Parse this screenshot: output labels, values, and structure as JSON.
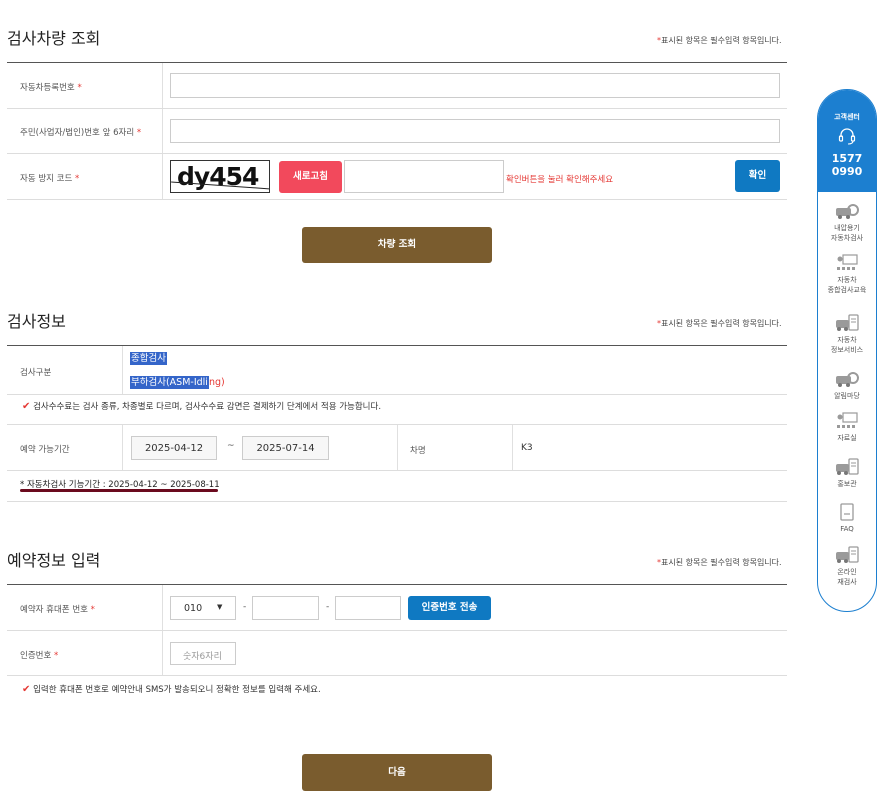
{
  "section1": {
    "title": "검사차량 조회",
    "note": "표시된 항목은 필수입력 항목입니다.",
    "fields": {
      "reg_no_label": "자동차등록번호",
      "id_label": "주민(사업자/법인)번호 앞 6자리",
      "captcha_label": "자동 방지 코드"
    },
    "captcha_text": "dy454",
    "refresh_label": "새로고침",
    "captcha_hint": "확인버튼을 눌러 확인해주세요",
    "confirm_label": "확인",
    "search_label": "차량 조회"
  },
  "section2": {
    "title": "검사정보",
    "note": "표시된 항목은 필수입력 항목입니다.",
    "type_label": "검사구분",
    "type_option1": "종합검사",
    "type_option2": "부하검사(ASM-Idli",
    "type_option2_tail": "ng)",
    "fee_notice": "검사수수료는 검사 종류, 차종별로 다르며, 검사수수료 감면은 결제하기 단계에서 적용 가능합니다.",
    "period_label": "예약 가능기간",
    "date_from": "2025-04-12",
    "date_sep": "~",
    "date_to": "2025-07-14",
    "car_name_label": "차명",
    "car_name_value": "K3",
    "inspect_period": "* 자동차검사 기능기간 : 2025-04-12 ~ 2025-08-11"
  },
  "section3": {
    "title": "예약정보 입력",
    "note": "표시된 항목은 필수입력 항목입니다.",
    "phone_label": "예약자 휴대폰 번호",
    "phone_prefix": "010",
    "dash": "-",
    "send_code_label": "인증번호 전송",
    "auth_label": "인증번호",
    "auth_placeholder": "숫자6자리",
    "sms_notice": "입력한 휴대폰 번호로 예약안내 SMS가 발송되오니 정확한 정보를 입력해 주세요.",
    "next_label": "다음"
  },
  "sidebar": {
    "title": "고객센터",
    "phone_line1": "1577",
    "phone_line2": "0990",
    "items": [
      {
        "line1": "내압용기",
        "line2": "자동차검사",
        "icon": "car-inspection-icon"
      },
      {
        "line1": "자동차",
        "line2": "종합검사교육",
        "icon": "education-icon"
      },
      {
        "line1": "자동차",
        "line2": "정보서비스",
        "icon": "info-service-icon"
      },
      {
        "line1": "알림마당",
        "line2": "",
        "icon": "notice-icon"
      },
      {
        "line1": "자료실",
        "line2": "",
        "icon": "archive-icon"
      },
      {
        "line1": "홍보관",
        "line2": "",
        "icon": "promotion-icon"
      },
      {
        "line1": "FAQ",
        "line2": "",
        "icon": "faq-icon"
      },
      {
        "line1": "온라인",
        "line2": "재검사",
        "icon": "online-reinspection-icon"
      }
    ]
  },
  "colors": {
    "brown": "#7a5c2e",
    "red": "#f2495c",
    "blue": "#0f79c2",
    "sidebar_blue": "#1c7fd0",
    "required": "#e53935",
    "underline": "#6b0a1e"
  }
}
